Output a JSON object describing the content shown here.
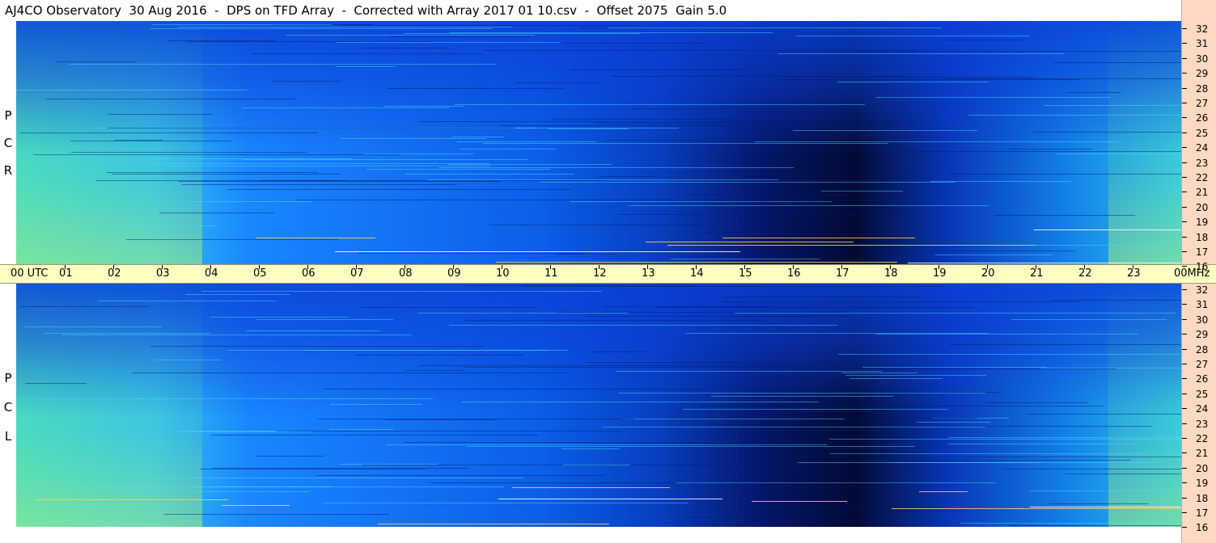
{
  "window": {
    "title": "AJ4CO Observatory  30 Aug 2016  -  DPS on TFD Array  -  Corrected with Array 2017 01 10.csv  -  Offset 2075  Gain 5.0"
  },
  "panels": [
    {
      "id": "rcp",
      "label_letters": [
        "P",
        "C",
        "R"
      ]
    },
    {
      "id": "lcp",
      "label_letters": [
        "P",
        "C",
        "L"
      ]
    }
  ],
  "freq_axis": {
    "ticks": [
      "32",
      "31",
      "30",
      "29",
      "28",
      "27",
      "26",
      "25",
      "24",
      "23",
      "22",
      "21",
      "20",
      "19",
      "18",
      "17",
      "16"
    ],
    "unit": "MHz"
  },
  "time_axis": {
    "first_label": "00  UTC",
    "labels": [
      "01",
      "02",
      "03",
      "04",
      "05",
      "06",
      "07",
      "08",
      "09",
      "10",
      "11",
      "12",
      "13",
      "14",
      "15",
      "16",
      "17",
      "18",
      "19",
      "20",
      "21",
      "22",
      "23"
    ],
    "last_label": "00",
    "unit": "MHz"
  },
  "colors": {
    "freq_axis_bg": "#ffd9c2",
    "time_axis_bg": "#ffffc2",
    "spectro_deep": "#000a3a",
    "spectro_blue": "#0a4fe0",
    "spectro_mid": "#1e8cff",
    "spectro_cyan": "#30d8e8",
    "spectro_green": "#8cf08c"
  }
}
